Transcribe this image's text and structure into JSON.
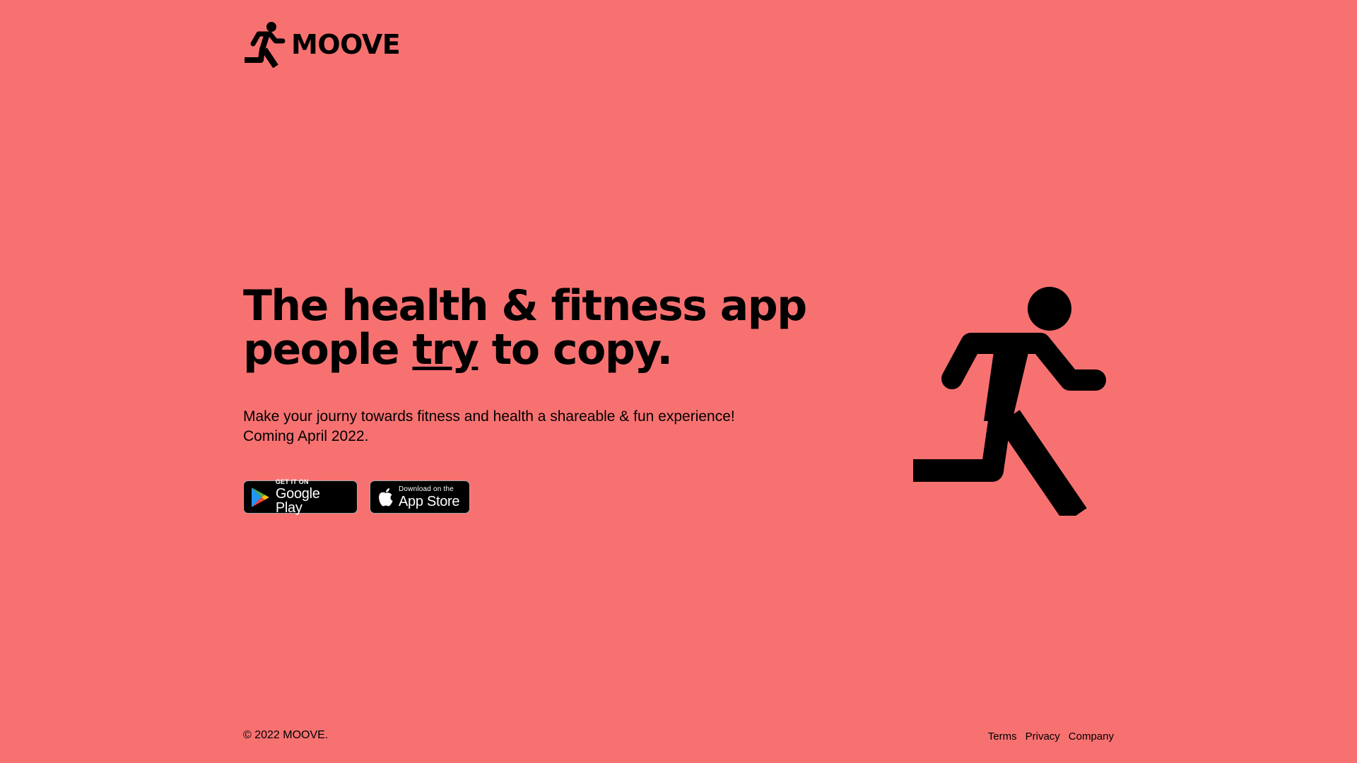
{
  "brand": {
    "name": "MOOVE",
    "logo_icon": "running-person-icon"
  },
  "hero": {
    "headline_line1": "The health & fitness app",
    "headline_pre": "people ",
    "headline_emphasis": "try",
    "headline_post": " to copy.",
    "subtext_line1": "Make your journy towards fitness and health a shareable & fun experience!",
    "subtext_line2": "Coming April 2022.",
    "illustration_icon": "running-person-icon"
  },
  "stores": {
    "google": {
      "small": "GET IT ON",
      "big": "Google Play",
      "icon": "google-play-icon"
    },
    "apple": {
      "small": "Download on the",
      "big": "App Store",
      "icon": "apple-icon"
    }
  },
  "footer": {
    "copyright": "© 2022 MOOVE.",
    "links": [
      "Terms",
      "Privacy",
      "Company"
    ]
  },
  "colors": {
    "background": "#f87171",
    "foreground": "#000000",
    "badge_background": "#000000"
  }
}
